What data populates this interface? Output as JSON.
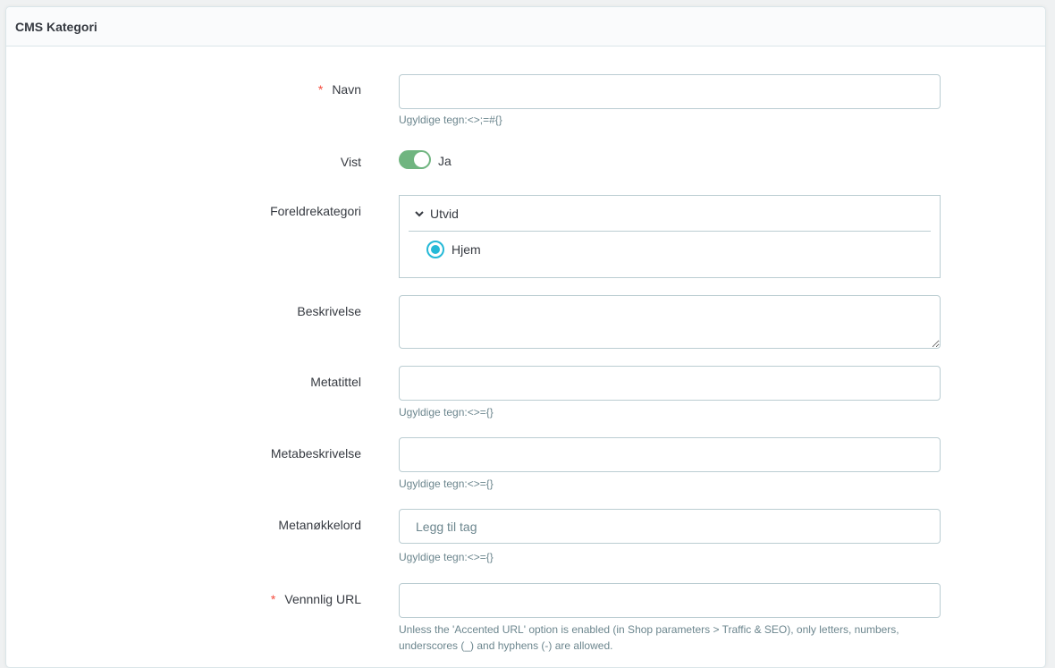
{
  "card": {
    "title": "CMS Kategori"
  },
  "form": {
    "name": {
      "label": "Navn",
      "required_mark": "*",
      "value": "",
      "hint": "Ugyldige tegn:<>;=#{}"
    },
    "displayed": {
      "label": "Vist",
      "state_label": "Ja",
      "on": true
    },
    "parent_category": {
      "label": "Foreldrekategori",
      "expand_label": "Utvid",
      "options": [
        {
          "label": "Hjem",
          "selected": true
        }
      ]
    },
    "description": {
      "label": "Beskrivelse",
      "value": ""
    },
    "meta_title": {
      "label": "Metatittel",
      "value": "",
      "hint": "Ugyldige tegn:<>={}"
    },
    "meta_description": {
      "label": "Metabeskrivelse",
      "value": "",
      "hint": "Ugyldige tegn:<>={}"
    },
    "meta_keywords": {
      "label": "Metanøkkelord",
      "placeholder": "Legg til tag",
      "hint": "Ugyldige tegn:<>={}"
    },
    "friendly_url": {
      "label": "Vennnlig URL",
      "required_mark": "*",
      "value": "",
      "hint": "Unless the 'Accented URL' option is enabled (in Shop parameters > Traffic & SEO), only letters, numbers, underscores (_) and hyphens (-) are allowed."
    }
  },
  "colors": {
    "accent": "#25b9d7",
    "switch_on": "#70b580",
    "required": "#f54c3e"
  }
}
